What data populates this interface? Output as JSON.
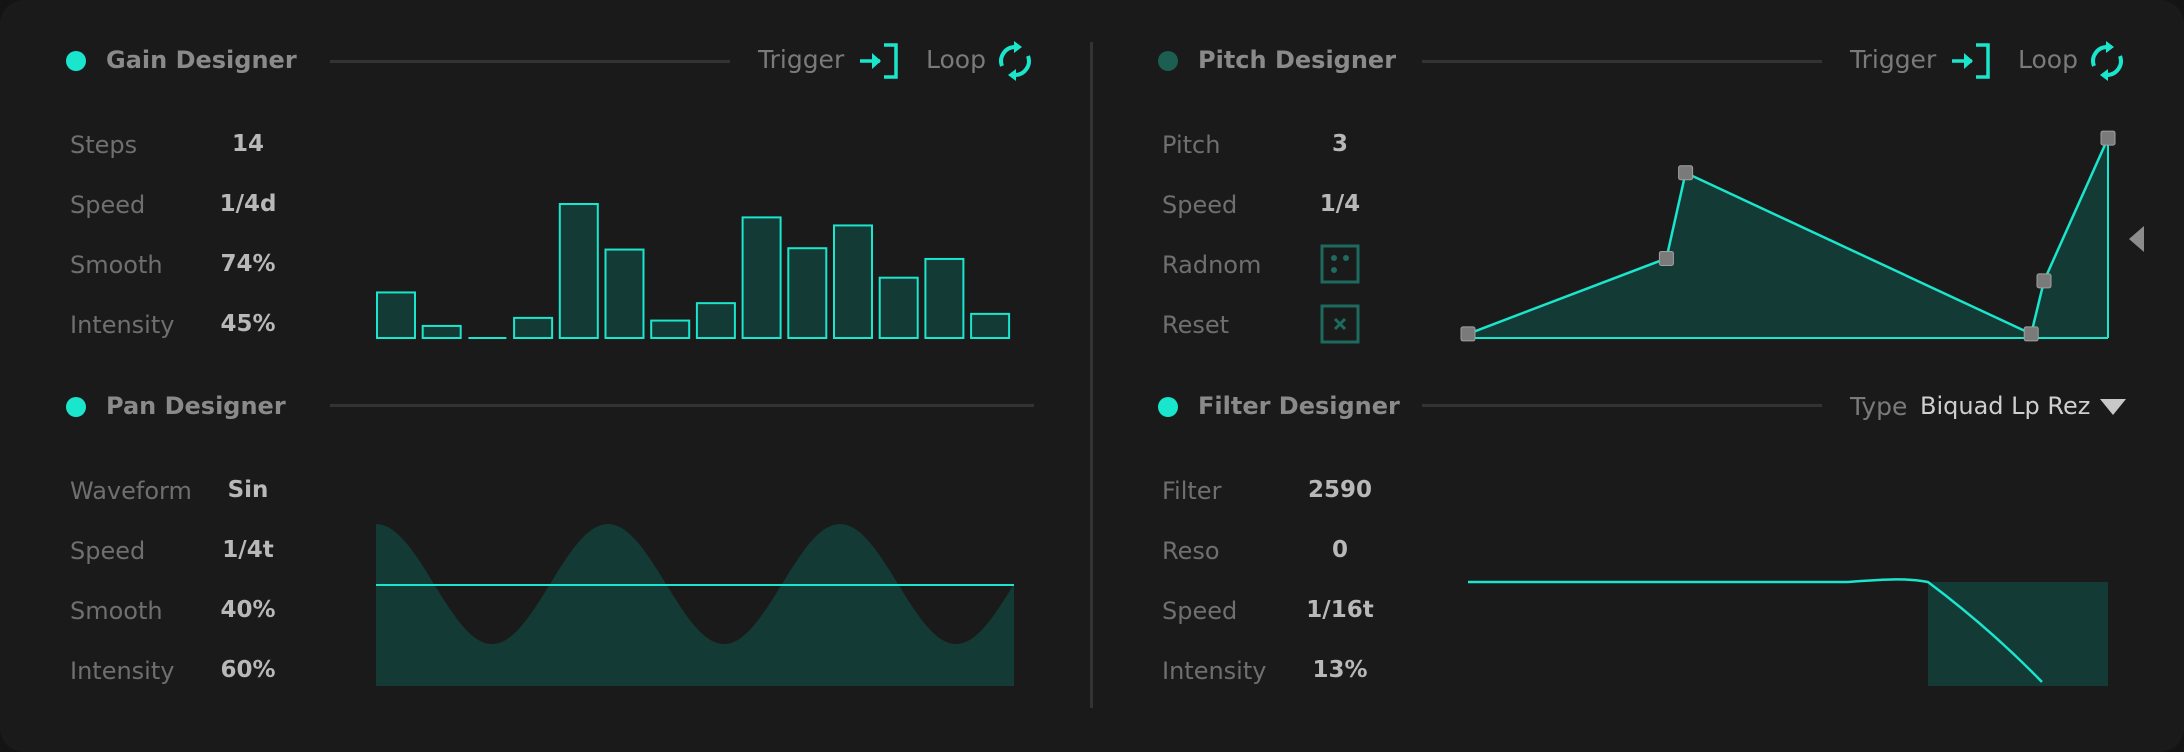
{
  "theme": {
    "accent": "#19e6cc",
    "accent_dim": "#1c5e52",
    "fill": "#143a35",
    "bg": "#1a1a1a"
  },
  "gain": {
    "title": "Gain Designer",
    "trigger_label": "Trigger",
    "loop_label": "Loop",
    "params": [
      {
        "label": "Steps",
        "value": "14"
      },
      {
        "label": "Speed",
        "value": "1/4d"
      },
      {
        "label": "Smooth",
        "value": "74%"
      },
      {
        "label": "Intensity",
        "value": "45%"
      }
    ],
    "steps": [
      0.34,
      0.09,
      0.0,
      0.15,
      1.0,
      0.66,
      0.13,
      0.26,
      0.9,
      0.67,
      0.84,
      0.45,
      0.59,
      0.18
    ]
  },
  "pitch": {
    "title": "Pitch Designer",
    "trigger_label": "Trigger",
    "loop_label": "Loop",
    "params": [
      {
        "label": "Pitch",
        "value": "3"
      },
      {
        "label": "Speed",
        "value": "1/4"
      },
      {
        "label": "Radnom",
        "icon": "dice-icon"
      },
      {
        "label": "Reset",
        "icon": "close-icon"
      }
    ],
    "points": [
      [
        0.0,
        0.02
      ],
      [
        0.31,
        0.39
      ],
      [
        0.34,
        0.81
      ],
      [
        0.88,
        0.02
      ],
      [
        0.9,
        0.28
      ],
      [
        1.0,
        0.98
      ]
    ]
  },
  "pan": {
    "title": "Pan Designer",
    "params": [
      {
        "label": "Waveform",
        "value": "Sin"
      },
      {
        "label": "Speed",
        "value": "1/4t"
      },
      {
        "label": "Smooth",
        "value": "40%"
      },
      {
        "label": "Intensity",
        "value": "60%"
      }
    ],
    "cycles": 2.75
  },
  "filter": {
    "title": "Filter Designer",
    "type_label": "Type",
    "type_value": "Biquad Lp Rez",
    "params": [
      {
        "label": "Filter",
        "value": "2590"
      },
      {
        "label": "Reso",
        "value": "0"
      },
      {
        "label": "Speed",
        "value": "1/16t"
      },
      {
        "label": "Intensity",
        "value": "13%"
      }
    ]
  }
}
